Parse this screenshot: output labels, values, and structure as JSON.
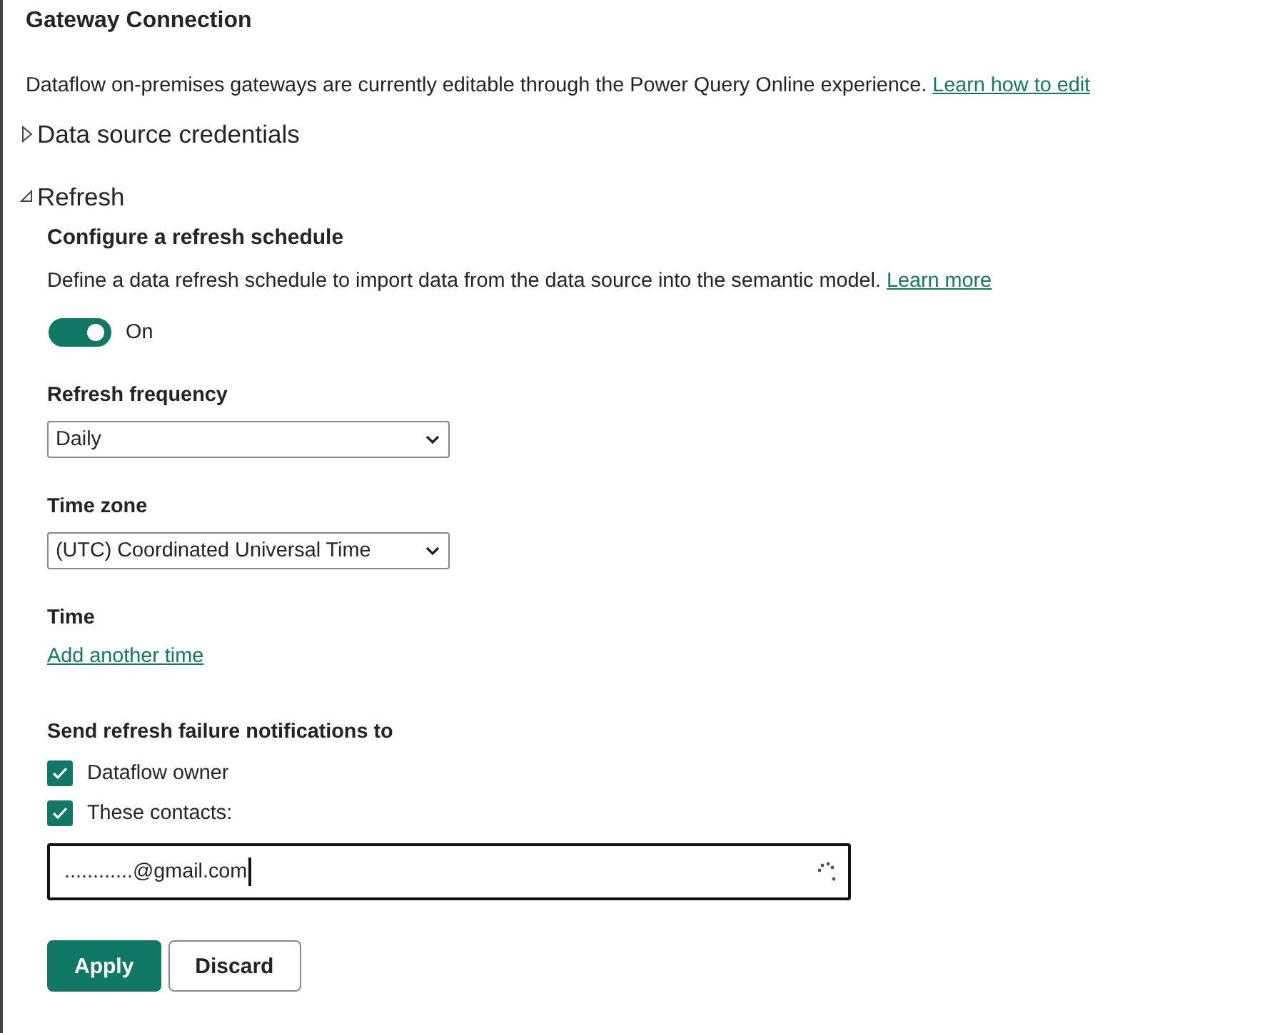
{
  "title": "Gateway Connection",
  "notice": {
    "text": "Dataflow on-premises gateways are currently editable through the Power Query Online experience.",
    "link": "Learn how to edit"
  },
  "sections": [
    {
      "label": "Data source credentials",
      "expanded": false
    },
    {
      "label": "Refresh",
      "expanded": true,
      "content": {
        "heading": "Configure a refresh schedule",
        "description": {
          "text": "Define a data refresh schedule to import data from the data source into the semantic model.",
          "link": "Learn more"
        },
        "toggle": {
          "on": true,
          "label": "On"
        },
        "fields": [
          {
            "kind": "select",
            "label": "Refresh frequency",
            "value": "Daily"
          },
          {
            "kind": "select",
            "label": "Time zone",
            "value": "(UTC) Coordinated Universal Time"
          },
          {
            "kind": "time",
            "label": "Time",
            "link": "Add another time"
          }
        ],
        "notifications": {
          "heading": "Send refresh failure notifications to",
          "options": [
            {
              "label": "Dataflow owner",
              "checked": true
            },
            {
              "label": "These contacts:",
              "checked": true
            }
          ],
          "contacts": {
            "value": "............@gmail.com",
            "loading": true
          }
        },
        "buttons": [
          {
            "label": "Apply",
            "kind": "primary"
          },
          {
            "label": "Discard",
            "kind": "secondary"
          }
        ]
      }
    }
  ]
}
